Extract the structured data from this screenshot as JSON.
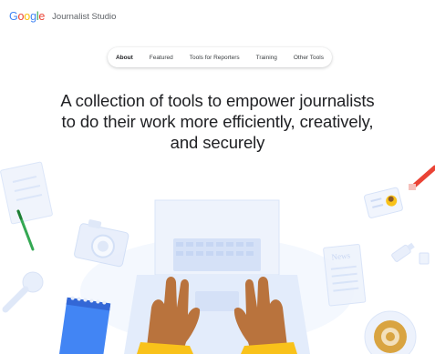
{
  "header": {
    "logo_letters": [
      {
        "char": "G",
        "color": "#4285F4"
      },
      {
        "char": "o",
        "color": "#EA4335"
      },
      {
        "char": "o",
        "color": "#FBBC05"
      },
      {
        "char": "g",
        "color": "#4285F4"
      },
      {
        "char": "l",
        "color": "#34A853"
      },
      {
        "char": "e",
        "color": "#EA4335"
      }
    ],
    "product_name": "Journalist Studio"
  },
  "nav": {
    "items": [
      {
        "label": "About",
        "active": true
      },
      {
        "label": "Featured",
        "active": false
      },
      {
        "label": "Tools for Reporters",
        "active": false
      },
      {
        "label": "Training",
        "active": false
      },
      {
        "label": "Other Tools",
        "active": false
      }
    ]
  },
  "hero": {
    "headline_line1": "A collection of tools to empower journalists",
    "headline_line2": "to do their work more efficiently, creatively,",
    "headline_line3": "and securely"
  },
  "illustration": {
    "newspaper_label": "News"
  },
  "colors": {
    "accent_blue": "#4285F4",
    "skin": "#B9733D",
    "sleeve": "#F9C21A",
    "laptop": "#E3ECFB"
  }
}
